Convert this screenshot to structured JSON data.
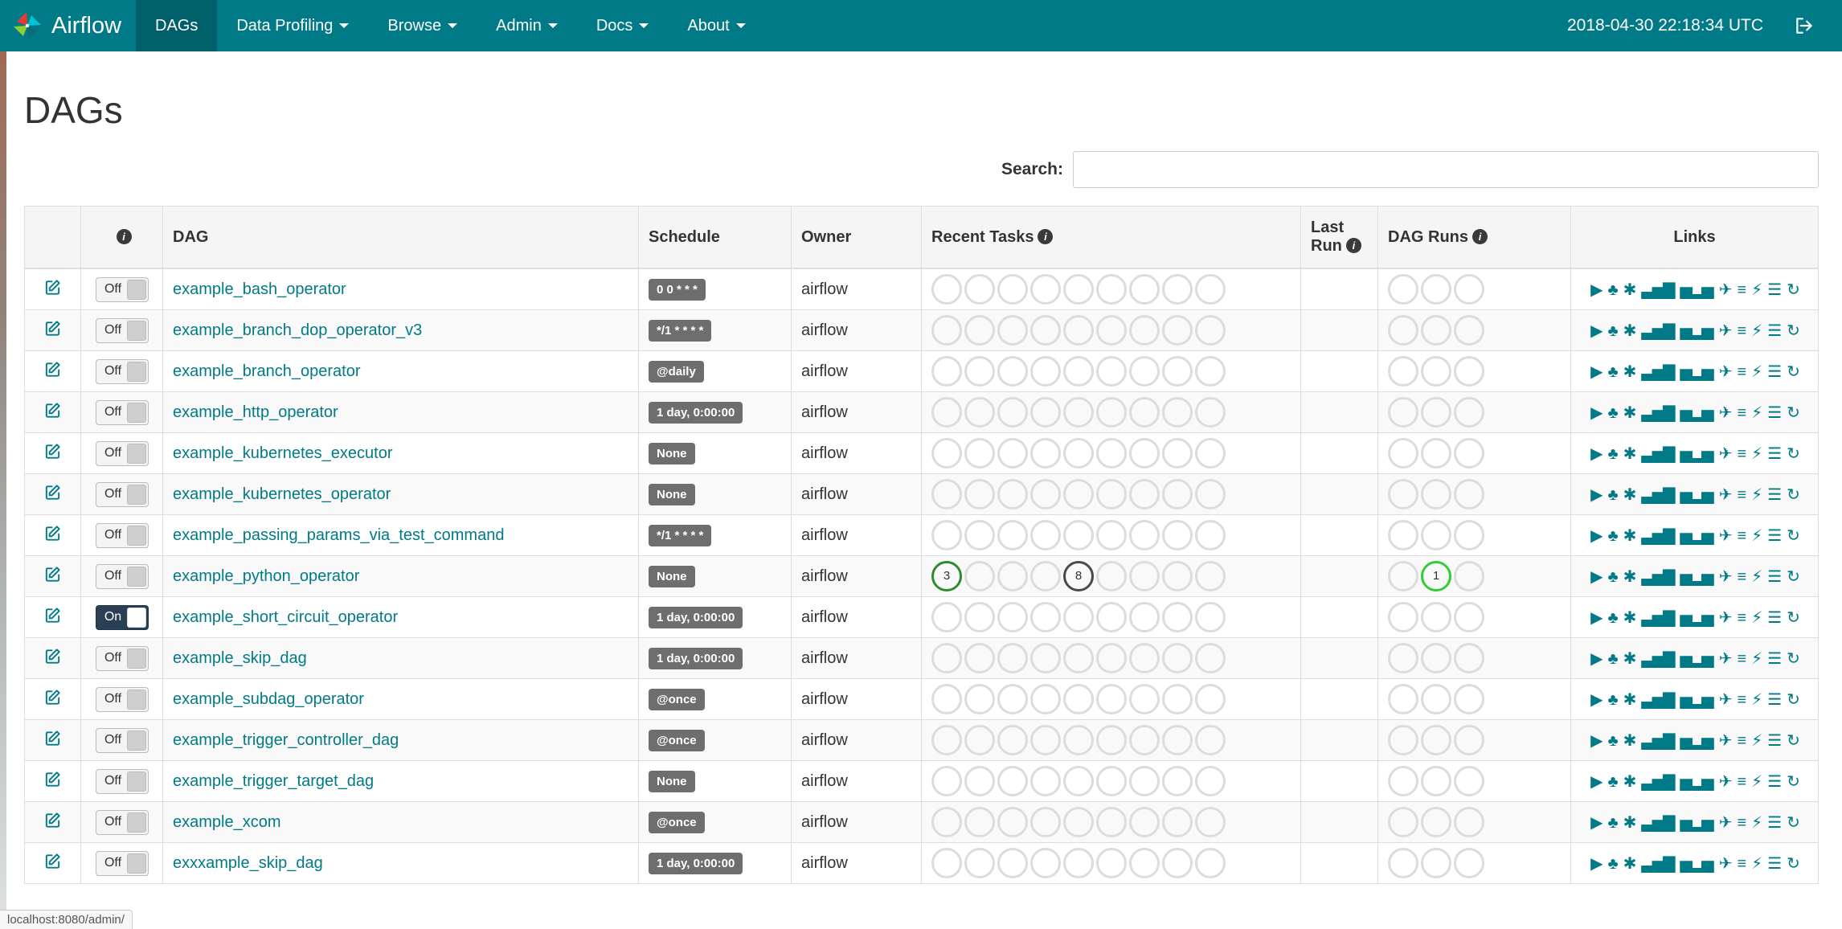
{
  "icons": {
    "info": "i"
  },
  "colors": {
    "navbar": "#007a87",
    "navbar_active": "#005f69",
    "link": "#007a87",
    "toggle_on": "#2a3f54",
    "badge": "#6e6e6e",
    "task_success": "#2e8b2e",
    "task_queued": "#4a4a4a",
    "run_running": "#32cd32"
  },
  "navbar": {
    "brand": "Airflow",
    "clock": "2018-04-30 22:18:34 UTC",
    "items": [
      {
        "label": "DAGs"
      },
      {
        "label": "Data Profiling"
      },
      {
        "label": "Browse"
      },
      {
        "label": "Admin"
      },
      {
        "label": "Docs"
      },
      {
        "label": "About"
      }
    ]
  },
  "page": {
    "title": "DAGs",
    "search_label": "Search:",
    "status_bar": "localhost:8080/admin/"
  },
  "table": {
    "headers": {
      "dag": "DAG",
      "schedule": "Schedule",
      "owner": "Owner",
      "recent_tasks": "Recent Tasks",
      "last_run": "Last Run",
      "dag_runs": "DAG Runs",
      "links": "Links"
    },
    "recent_task_slots": 9,
    "dag_run_slots": 3,
    "links_icons": [
      {
        "name": "trigger-dag-icon",
        "glyph": "▶"
      },
      {
        "name": "tree-view-icon",
        "glyph": "♣"
      },
      {
        "name": "graph-view-icon",
        "glyph": "✱"
      },
      {
        "name": "task-duration-icon",
        "glyph": "▃▅▇"
      },
      {
        "name": "task-tries-icon",
        "glyph": "▅▂▅"
      },
      {
        "name": "landing-times-icon",
        "glyph": "✈"
      },
      {
        "name": "gantt-icon",
        "glyph": "≡"
      },
      {
        "name": "code-view-icon",
        "glyph": "⚡"
      },
      {
        "name": "dag-details-icon",
        "glyph": "☰"
      },
      {
        "name": "refresh-icon",
        "glyph": "↻"
      }
    ],
    "rows": [
      {
        "name": "example_bash_operator",
        "toggle": "Off",
        "schedule": "0 0 * * *",
        "owner": "airflow",
        "recent_tasks": [],
        "dag_runs": []
      },
      {
        "name": "example_branch_dop_operator_v3",
        "toggle": "Off",
        "schedule": "*/1 * * * *",
        "owner": "airflow",
        "recent_tasks": [],
        "dag_runs": []
      },
      {
        "name": "example_branch_operator",
        "toggle": "Off",
        "schedule": "@daily",
        "owner": "airflow",
        "recent_tasks": [],
        "dag_runs": []
      },
      {
        "name": "example_http_operator",
        "toggle": "Off",
        "schedule": "1 day, 0:00:00",
        "owner": "airflow",
        "recent_tasks": [],
        "dag_runs": []
      },
      {
        "name": "example_kubernetes_executor",
        "toggle": "Off",
        "schedule": "None",
        "owner": "airflow",
        "recent_tasks": [],
        "dag_runs": []
      },
      {
        "name": "example_kubernetes_operator",
        "toggle": "Off",
        "schedule": "None",
        "owner": "airflow",
        "recent_tasks": [],
        "dag_runs": []
      },
      {
        "name": "example_passing_params_via_test_command",
        "toggle": "Off",
        "schedule": "*/1 * * * *",
        "owner": "airflow",
        "recent_tasks": [],
        "dag_runs": []
      },
      {
        "name": "example_python_operator",
        "toggle": "Off",
        "schedule": "None",
        "owner": "airflow",
        "recent_tasks": [
          {
            "slot": 0,
            "count": 3,
            "color": "#2e8b2e"
          },
          {
            "slot": 4,
            "count": 8,
            "color": "#4a4a4a"
          }
        ],
        "dag_runs": [
          {
            "slot": 1,
            "count": 1,
            "color": "#32cd32"
          }
        ]
      },
      {
        "name": "example_short_circuit_operator",
        "toggle": "On",
        "schedule": "1 day, 0:00:00",
        "owner": "airflow",
        "recent_tasks": [],
        "dag_runs": []
      },
      {
        "name": "example_skip_dag",
        "toggle": "Off",
        "schedule": "1 day, 0:00:00",
        "owner": "airflow",
        "recent_tasks": [],
        "dag_runs": []
      },
      {
        "name": "example_subdag_operator",
        "toggle": "Off",
        "schedule": "@once",
        "owner": "airflow",
        "recent_tasks": [],
        "dag_runs": []
      },
      {
        "name": "example_trigger_controller_dag",
        "toggle": "Off",
        "schedule": "@once",
        "owner": "airflow",
        "recent_tasks": [],
        "dag_runs": []
      },
      {
        "name": "example_trigger_target_dag",
        "toggle": "Off",
        "schedule": "None",
        "owner": "airflow",
        "recent_tasks": [],
        "dag_runs": []
      },
      {
        "name": "example_xcom",
        "toggle": "Off",
        "schedule": "@once",
        "owner": "airflow",
        "recent_tasks": [],
        "dag_runs": []
      },
      {
        "name": "exxxample_skip_dag",
        "toggle": "Off",
        "schedule": "1 day, 0:00:00",
        "owner": "airflow",
        "recent_tasks": [],
        "dag_runs": []
      }
    ]
  }
}
